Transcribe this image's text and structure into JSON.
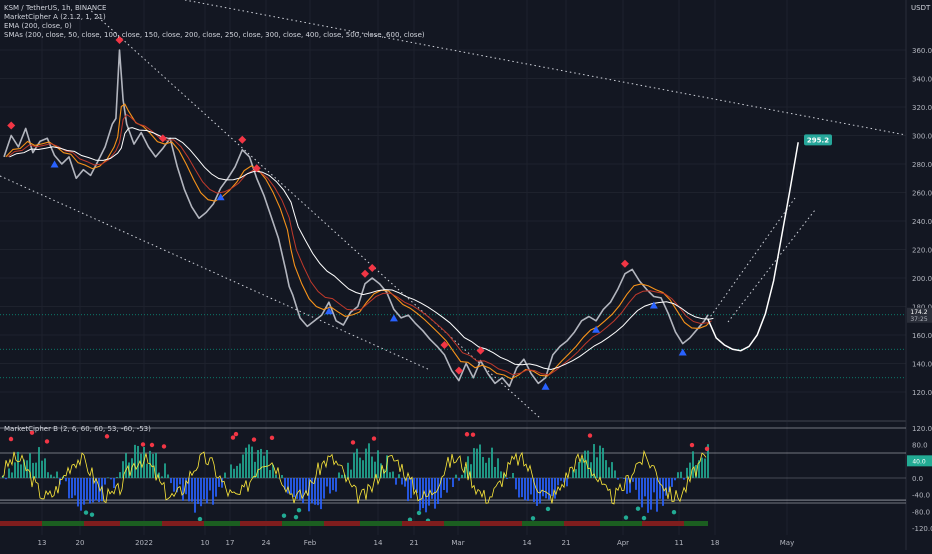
{
  "header": {
    "symbol_line": "KSM / TetherUS, 1h, BINANCE",
    "indicator_1": "MarketCipher A (2.1.2, 1, 21)",
    "indicator_2": "EMA (200, close, 0)",
    "indicator_3": "SMAs (200, close, 50, close, 100, close, 150, close, 200, close, 250, close, 300, close, 400, close, 500, close, 600, close)",
    "currency": "USDT"
  },
  "oscillator": {
    "title": "MarketCipher B (2, 6, 60, 60, 53, -60, -53)",
    "yticks": [
      120.0,
      80.0,
      40.0,
      0.0,
      -40.0,
      -80.0,
      -120.0
    ],
    "badge_a": "40.0",
    "badge_b": "0.0"
  },
  "price_labels": {
    "target": "295.2",
    "current": "174.2",
    "countdown": "37:25"
  },
  "chart_data": {
    "type": "line",
    "title": "KSM / TetherUS, 1h, BINANCE",
    "xlabel": "",
    "ylabel": "",
    "yticks": [
      120.0,
      140.0,
      160.0,
      180.0,
      200.0,
      220.0,
      240.0,
      260.0,
      280.0,
      300.0,
      320.0,
      340.0,
      360.0
    ],
    "ylim": [
      105,
      375
    ],
    "xticks": [
      "13",
      "20",
      "2022",
      "10",
      "17",
      "24",
      "Feb",
      "14",
      "21",
      "Mar",
      "14",
      "21",
      "Apr",
      "11",
      "18",
      "May"
    ],
    "x_unit": "days since Dec 13 2021",
    "xlim": [
      -5.3,
      146
    ],
    "series": [
      {
        "name": "KSM/USDT",
        "type": "price",
        "points": [
          [
            -5,
            285
          ],
          [
            -3,
            300
          ],
          [
            -1,
            292
          ],
          [
            1,
            305
          ],
          [
            3,
            288
          ],
          [
            5,
            296
          ],
          [
            7,
            298
          ],
          [
            9,
            286
          ],
          [
            11,
            280
          ],
          [
            13,
            285
          ],
          [
            15,
            270
          ],
          [
            17,
            276
          ],
          [
            19,
            272
          ],
          [
            21,
            282
          ],
          [
            23,
            292
          ],
          [
            25,
            308
          ],
          [
            26,
            312
          ],
          [
            27,
            360
          ],
          [
            28,
            325
          ],
          [
            29,
            308
          ],
          [
            31,
            294
          ],
          [
            33,
            302
          ],
          [
            35,
            292
          ],
          [
            37,
            285
          ],
          [
            39,
            291
          ],
          [
            41,
            298
          ],
          [
            43,
            278
          ],
          [
            45,
            262
          ],
          [
            47,
            250
          ],
          [
            49,
            242
          ],
          [
            51,
            246
          ],
          [
            53,
            252
          ],
          [
            55,
            263
          ],
          [
            57,
            270
          ],
          [
            59,
            278
          ],
          [
            61,
            290
          ],
          [
            63,
            285
          ],
          [
            65,
            270
          ],
          [
            67,
            258
          ],
          [
            69,
            243
          ],
          [
            71,
            228
          ],
          [
            73,
            206
          ],
          [
            74,
            194
          ],
          [
            75,
            188
          ],
          [
            77,
            172
          ],
          [
            79,
            166
          ],
          [
            81,
            170
          ],
          [
            83,
            174
          ],
          [
            85,
            183
          ],
          [
            87,
            170
          ],
          [
            89,
            167
          ],
          [
            91,
            176
          ],
          [
            93,
            180
          ],
          [
            95,
            196
          ],
          [
            97,
            200
          ],
          [
            99,
            196
          ],
          [
            101,
            190
          ],
          [
            103,
            178
          ],
          [
            105,
            172
          ],
          [
            107,
            174
          ],
          [
            109,
            168
          ],
          [
            111,
            163
          ],
          [
            113,
            157
          ],
          [
            115,
            152
          ],
          [
            117,
            146
          ],
          [
            119,
            135
          ],
          [
            121,
            128
          ],
          [
            123,
            140
          ],
          [
            125,
            130
          ],
          [
            127,
            142
          ],
          [
            129,
            133
          ],
          [
            131,
            126
          ],
          [
            133,
            130
          ],
          [
            135,
            124
          ],
          [
            137,
            137
          ],
          [
            139,
            143
          ],
          [
            141,
            133
          ],
          [
            143,
            126
          ],
          [
            145,
            130
          ],
          [
            147,
            146
          ],
          [
            149,
            152
          ],
          [
            151,
            156
          ],
          [
            153,
            162
          ],
          [
            155,
            170
          ],
          [
            157,
            173
          ],
          [
            159,
            170
          ],
          [
            161,
            178
          ],
          [
            163,
            183
          ],
          [
            165,
            192
          ],
          [
            167,
            203
          ],
          [
            169,
            206
          ],
          [
            171,
            198
          ],
          [
            173,
            192
          ],
          [
            175,
            187
          ],
          [
            177,
            186
          ],
          [
            179,
            175
          ],
          [
            181,
            162
          ],
          [
            183,
            154
          ],
          [
            185,
            158
          ],
          [
            187,
            164
          ],
          [
            189,
            170
          ],
          [
            190,
            174.2
          ]
        ],
        "x_unit_override": "index"
      },
      {
        "name": "projection",
        "type": "curve",
        "points": [
          [
            0,
            171
          ],
          [
            1,
            158
          ],
          [
            2,
            153
          ],
          [
            3,
            150
          ],
          [
            4,
            149
          ],
          [
            5,
            152
          ],
          [
            6,
            160
          ],
          [
            7,
            175
          ],
          [
            8,
            198
          ],
          [
            9,
            230
          ],
          [
            10,
            262
          ],
          [
            11,
            295.2
          ]
        ]
      }
    ],
    "annotations": [
      {
        "type": "label",
        "text": "295.2",
        "value": 295.2
      },
      {
        "type": "label",
        "text": "174.2",
        "value": 174.2
      },
      {
        "type": "label",
        "text": "37:25",
        "value": 174.2
      }
    ]
  },
  "colors": {
    "background": "#131722",
    "price": "#b2b5be",
    "ema": "#f7931a",
    "sma_red": "#c0392b",
    "sma_white": "#ffffff",
    "dotted": "#d1d4dc",
    "target_badge": "#26a69a",
    "current_badge": "#2a2e39",
    "level_green": "#089981",
    "osc_red": "#f23645",
    "osc_green": "#22ab94",
    "osc_blue": "#2962ff",
    "osc_yellow": "#ffeb3b"
  }
}
